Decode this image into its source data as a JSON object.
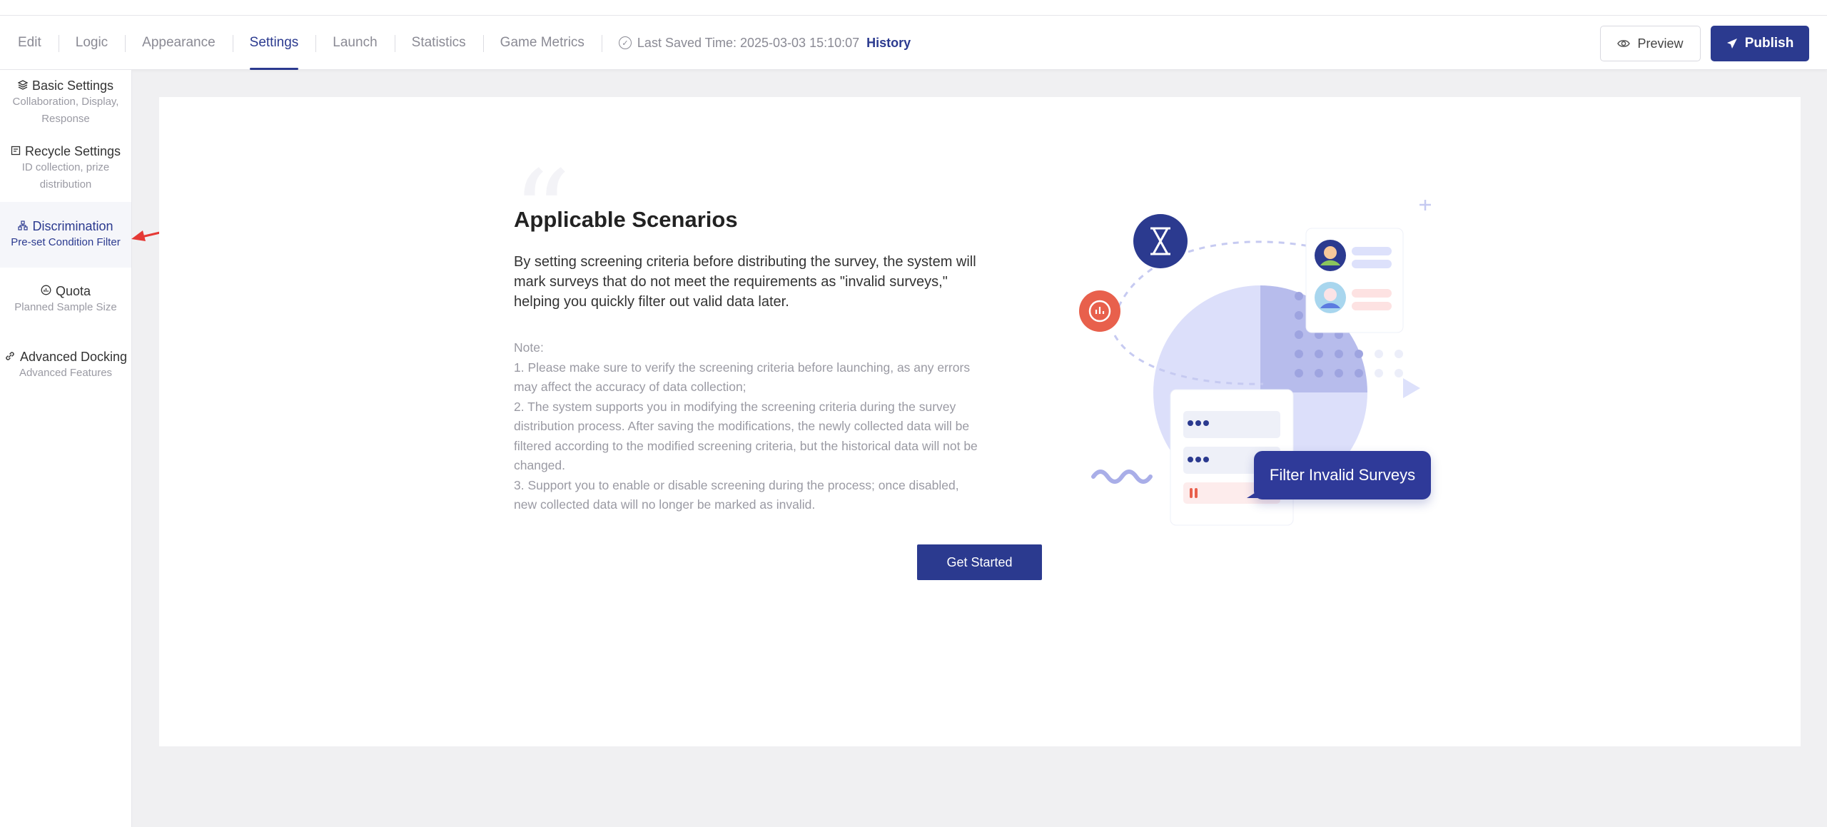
{
  "nav": {
    "tabs": [
      "Edit",
      "Logic",
      "Appearance",
      "Settings",
      "Launch",
      "Statistics",
      "Game Metrics"
    ],
    "active_tab": "Settings",
    "saved_text": "Last Saved Time: 2025-03-03 15:10:07",
    "history_label": "History",
    "preview_label": "Preview",
    "publish_label": "Publish"
  },
  "sidebar": {
    "items": [
      {
        "title": "Basic Settings",
        "sub": "Collaboration, Display, Response",
        "icon": "layers-icon"
      },
      {
        "title": "Recycle Settings",
        "sub": "ID collection, prize distribution",
        "icon": "recycle-icon"
      },
      {
        "title": "Discrimination",
        "sub": "Pre-set Condition Filter",
        "icon": "hierarchy-icon"
      },
      {
        "title": "Quota",
        "sub": "Planned Sample Size",
        "icon": "quota-icon"
      },
      {
        "title": "Advanced Docking",
        "sub": "Advanced Features",
        "icon": "link-icon"
      }
    ],
    "active_index": 2
  },
  "content": {
    "heading": "Applicable Scenarios",
    "description": "By setting screening criteria before distributing the survey, the system will mark surveys that do not meet the requirements as \"invalid surveys,\" helping you quickly filter out valid data later.",
    "note_label": "Note:",
    "note_1": "1. Please make sure to verify the screening criteria before launching, as any errors may affect the accuracy of data collection;",
    "note_2": "2. The system supports you in modifying the screening criteria during the survey distribution process. After saving the modifications, the newly collected data will be filtered according to the modified screening criteria, but the historical data will not be changed.",
    "note_3": "3. Support you to enable or disable screening during the process; once disabled, new collected data will no longer be marked as invalid.",
    "button_label": "Get Started",
    "illustration_label": "Filter Invalid Surveys"
  },
  "colors": {
    "primary": "#2b3a8f",
    "accent_red": "#e8604c",
    "annotation_arrow": "#e53935"
  }
}
